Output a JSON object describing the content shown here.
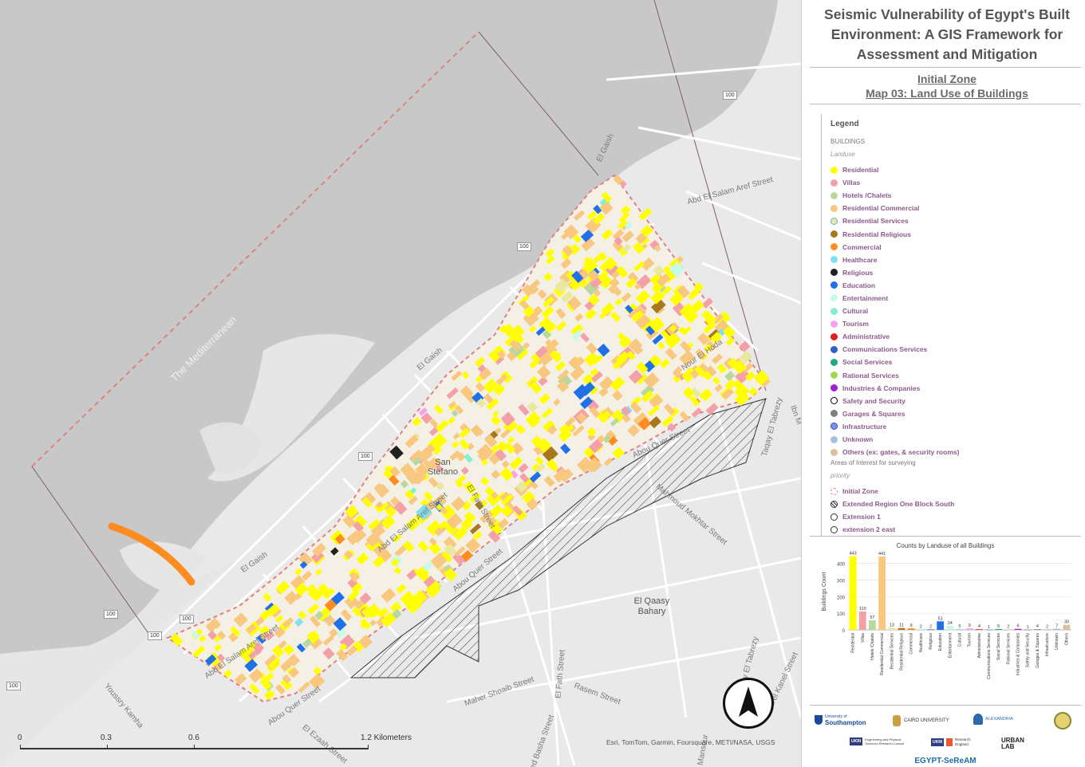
{
  "map": {
    "labels": {
      "sea": "The Mediterranean",
      "san_stefano": "San Stefano",
      "el_qaasy": "El Qaasy Bahary",
      "el_gaish": "El Gaish",
      "abd_el_salam_aref": "Abd El Salam Aref Street",
      "el_fath": "El Fath Street",
      "abou_quer": "Abou Quer Street",
      "nour_el_hoda": "Nour El Hoda",
      "mokhtar": "Mahmoud Mokhtar Street",
      "taqay": "Taqay El Tabrezy",
      "maher_shoaib": "Maher Shoaib Street",
      "rasem": "Rasem Street",
      "youssry_kamha": "Youssry Kamha",
      "el_ezaah": "El Ezaah Street",
      "ibn": "Ibn M",
      "kanel": "Karel Kanel Street",
      "mansour": "Mansour",
      "ahmed_basha": "Ahmed Basha Street",
      "route": "100"
    },
    "scale": {
      "ticks": [
        "0",
        "0.3",
        "0.6",
        "1.2 Kilometers"
      ]
    },
    "attribution": "Esri, TomTom, Garmin, Foursquare, METI/NASA, USGS",
    "north_arrow": "north-arrow-icon"
  },
  "panel": {
    "title_lines": [
      "Seismic Vulnerability of Egypt's Built",
      "Environment: A GIS Framework for",
      "Assessment and Mitigation"
    ],
    "subtitle": "Initial Zone",
    "subtitle2": "Map 03: Land Use of Buildings"
  },
  "legend": {
    "heading": "Legend",
    "section": "BUILDINGS",
    "subsection": "Landuse",
    "items": [
      {
        "label": "Residential",
        "color": "#ffff00"
      },
      {
        "label": "Villas",
        "color": "#f4a0a8"
      },
      {
        "label": "Hotels /Chalets",
        "color": "#b8d8a0"
      },
      {
        "label": "Residential Commercial",
        "color": "#f8c880"
      },
      {
        "label": "Residential Services",
        "color": "#e8e8a0",
        "border": "#60b0e0"
      },
      {
        "label": "Residential Religious",
        "color": "#a87820"
      },
      {
        "label": "Commercial",
        "color": "#ff8c20"
      },
      {
        "label": "Healthcare",
        "color": "#80e0f0"
      },
      {
        "label": "Religious",
        "color": "#202020"
      },
      {
        "label": "Education",
        "color": "#2070e8"
      },
      {
        "label": "Entertainment",
        "color": "#c8f8e8"
      },
      {
        "label": "Cultural",
        "color": "#80f0d0"
      },
      {
        "label": "Tourism",
        "color": "#f8a0f0"
      },
      {
        "label": "Administrative",
        "color": "#e02020"
      },
      {
        "label": "Communications Services",
        "color": "#3060c8"
      },
      {
        "label": "Social Services",
        "color": "#20a880"
      },
      {
        "label": "Rational Services",
        "color": "#a0d850"
      },
      {
        "label": "Industries & Companies",
        "color": "#a020d0"
      },
      {
        "label": "Safety and Security",
        "color": "#ffffff",
        "border": "#000000"
      },
      {
        "label": "Garages & Squares",
        "color": "#808080"
      },
      {
        "label": "Infrastructure",
        "color": "#8090f0",
        "border": "#3050c0"
      },
      {
        "label": "Unknown",
        "color": "#a8c0e0"
      },
      {
        "label": "Others (ex: gates, & security rooms)",
        "color": "#d8c0a0"
      }
    ],
    "aoi": "Areas of Interest for surveying",
    "priority": "priority",
    "zones": [
      {
        "label": "Initial Zone",
        "kind": "dashed"
      },
      {
        "label": "Extended Region One Block South",
        "kind": "hatched"
      },
      {
        "label": "Extension 1",
        "kind": "circle"
      },
      {
        "label": "extension 2 east",
        "kind": "circle"
      }
    ]
  },
  "chart_data": {
    "type": "bar",
    "title": "Counts by Landuse of all Buildings",
    "ylabel": "Buildings Count",
    "xlabel": "",
    "ylim": [
      0,
      460
    ],
    "yticks": [
      0,
      100,
      200,
      300,
      400
    ],
    "categories": [
      "Residential",
      "Villas",
      "Hotels /Chalets",
      "Residential Commercial",
      "Residential Services",
      "Residential Religious",
      "Commercial",
      "Healthcare",
      "Religious",
      "Education",
      "Entertainment",
      "Cultural",
      "Tourism",
      "Administrative",
      "Communications Services",
      "Social Services",
      "Rational Services",
      "Industries & Companies",
      "Safety and Security",
      "Garages & Squares",
      "Infrastructure",
      "Unknown",
      "Others"
    ],
    "values": [
      443,
      110,
      57,
      441,
      13,
      11,
      9,
      2,
      2,
      51,
      24,
      5,
      9,
      4,
      1,
      5,
      2,
      6,
      1,
      4,
      2,
      7,
      30
    ],
    "colors": [
      "#ffff00",
      "#f4a0a8",
      "#b8d8a0",
      "#f8c880",
      "#e8e8a0",
      "#a87820",
      "#ff8c20",
      "#80e0f0",
      "#202020",
      "#2070e8",
      "#c8f8e8",
      "#80f0d0",
      "#f8a0f0",
      "#e02020",
      "#3060c8",
      "#20a880",
      "#a0d850",
      "#a020d0",
      "#606060",
      "#808080",
      "#8090f0",
      "#a8c0e0",
      "#d8c0a0"
    ],
    "grid": true
  },
  "logos": {
    "southampton_small": "University of",
    "southampton": "Southampton",
    "cairo": "CAIRO UNIVERSITY",
    "alexandria": "ALEXANDRIA",
    "epsrc": "Engineering and Physical Sciences Research Council",
    "research_england": "Research England",
    "urban_lab": "URBAN LAB",
    "ukri": "UKRI",
    "footer": "EGYPT-SeReAM"
  }
}
